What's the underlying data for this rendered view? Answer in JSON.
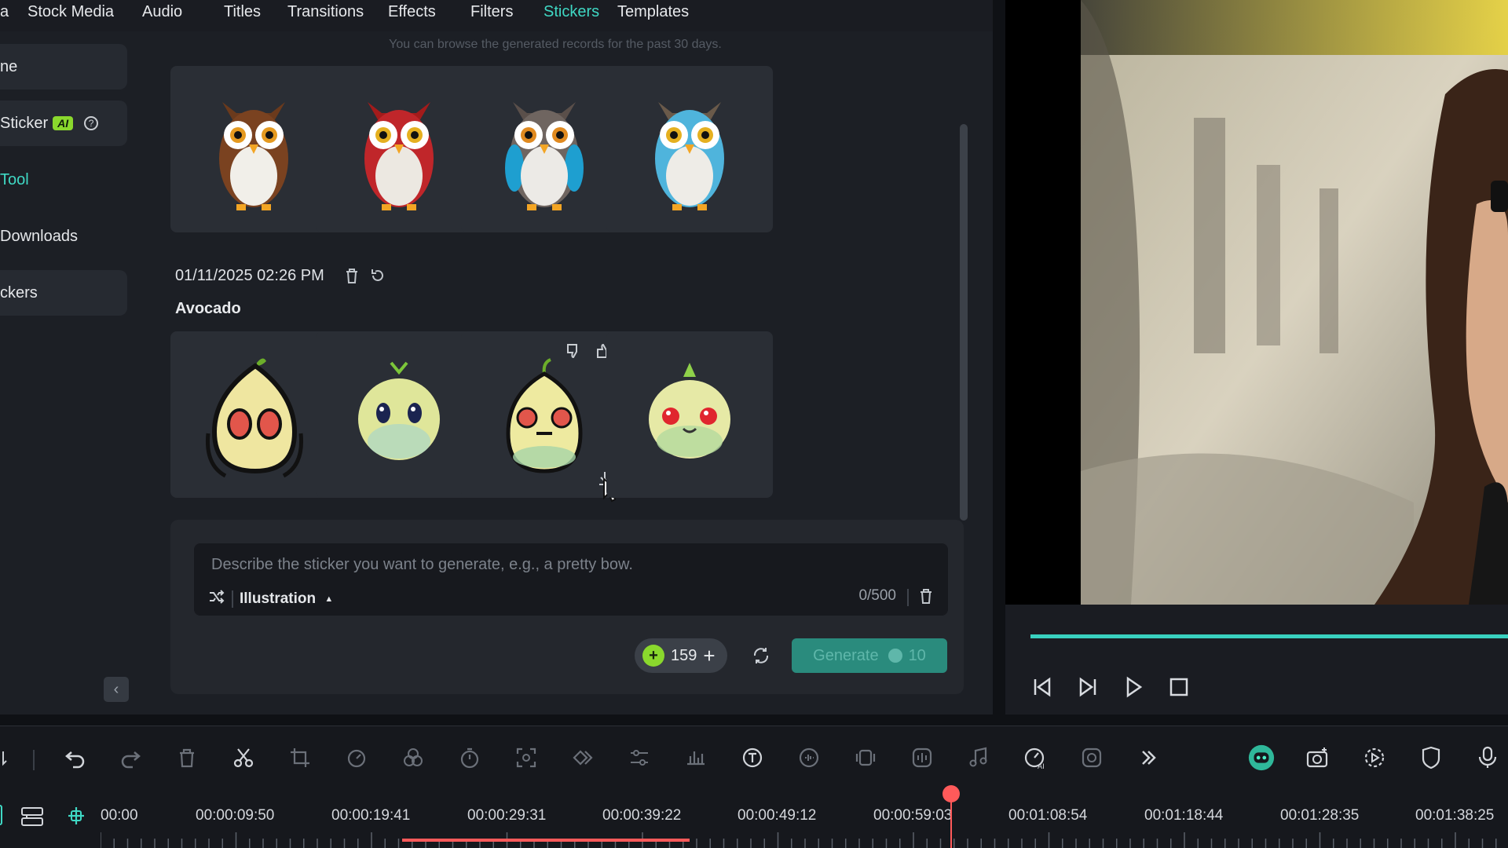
{
  "topnav": {
    "items": [
      {
        "label": "a"
      },
      {
        "label": "Stock Media"
      },
      {
        "label": "Audio"
      },
      {
        "label": "Titles"
      },
      {
        "label": "Transitions"
      },
      {
        "label": "Effects"
      },
      {
        "label": "Filters"
      },
      {
        "label": "Stickers",
        "active": true
      },
      {
        "label": "Templates"
      }
    ]
  },
  "sidebar": {
    "items": [
      {
        "label": "ne"
      },
      {
        "label": "Sticker",
        "badge": "AI"
      },
      {
        "label": "Tool"
      },
      {
        "label": "Downloads"
      },
      {
        "label": "ckers"
      }
    ],
    "help_icon": "?",
    "collapse_icon": "‹"
  },
  "content": {
    "hint": "You can browse the generated records for the past 30 days.",
    "owls": [
      "owl-brown",
      "owl-red",
      "owl-blue-grey",
      "owl-cyan"
    ],
    "record": {
      "timestamp": "01/11/2025 02:26 PM",
      "name": "Avocado"
    },
    "avocados": [
      "avocado-1",
      "avocado-2",
      "avocado-3",
      "avocado-4"
    ]
  },
  "prompt": {
    "placeholder": "Describe the sticker you want to generate, e.g., a pretty bow.",
    "style": "Illustration",
    "style_caret": "▲",
    "counter": "0/500"
  },
  "credits": {
    "value": "159",
    "plus": "+",
    "dot": "+"
  },
  "generate": {
    "label": "Generate",
    "cost": "10"
  },
  "preview": {
    "progress": 1.0
  },
  "timeline": {
    "ticks": [
      "00:00",
      "00:00:09:50",
      "00:00:19:41",
      "00:00:29:31",
      "00:00:39:22",
      "00:00:49:12",
      "00:00:59:03",
      "00:01:08:54",
      "00:01:18:44",
      "00:01:28:35",
      "00:01:38:25"
    ]
  },
  "colors": {
    "accent": "#3fd8c4",
    "ai_badge": "#8ad82d",
    "playhead": "#ff5a5a"
  }
}
